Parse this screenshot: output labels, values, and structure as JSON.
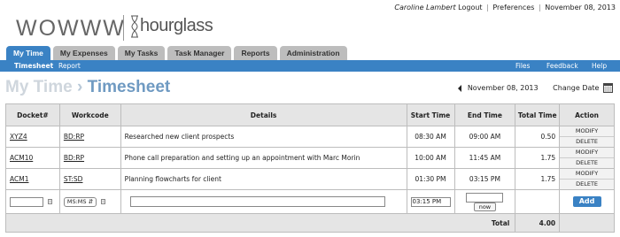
{
  "brand": {
    "logo_text": "WOWWW",
    "product_text": "hourglass"
  },
  "user_bar": {
    "user": "Caroline Lambert",
    "logout": "Logout",
    "preferences": "Preferences",
    "date": "November 08, 2013",
    "sep": "|"
  },
  "tabs": [
    {
      "label": "My Time"
    },
    {
      "label": "My Expenses"
    },
    {
      "label": "My Tasks"
    },
    {
      "label": "Task Manager"
    },
    {
      "label": "Reports"
    },
    {
      "label": "Administration"
    }
  ],
  "subnav": {
    "timesheet": "Timesheet",
    "report": "Report",
    "files": "Files",
    "feedback": "Feedback",
    "help": "Help"
  },
  "title": {
    "part1": "My Time",
    "arrow": "›",
    "part2": "Timesheet"
  },
  "date_nav": {
    "date": "November 08, 2013",
    "change_label": "Change Date"
  },
  "columns": [
    "Docket#",
    "Workcode",
    "Details",
    "Start Time",
    "End Time",
    "Total Time",
    "Action"
  ],
  "rows": [
    {
      "docket": "XYZ4",
      "workcode": "BD:RP",
      "details": "Researched new client prospects",
      "start": "08:30 AM",
      "end": "09:00 AM",
      "total": "0.50"
    },
    {
      "docket": "ACM10",
      "workcode": "BD:RP",
      "details": "Phone call preparation and setting up an appointment with Marc Morin",
      "start": "10:00 AM",
      "end": "11:45 AM",
      "total": "1.75"
    },
    {
      "docket": "ACM1",
      "workcode": "ST:SD",
      "details": "Planning flowcharts for client",
      "start": "01:30 PM",
      "end": "03:15 PM",
      "total": "1.75"
    }
  ],
  "actions": {
    "modify": "MODIFY",
    "delete": "DELETE"
  },
  "new_entry": {
    "docket_value": "",
    "workcode_selected": "MS:MS",
    "details_value": "",
    "start_value": "03:15 PM",
    "end_value": "",
    "now_label": "now",
    "add_label": "Add"
  },
  "total": {
    "label": "Total",
    "value": "4.00"
  },
  "colors": {
    "accent": "#3a82c4",
    "tab_inactive": "#bdbdbd",
    "header_gray": "#e5e5e5"
  }
}
